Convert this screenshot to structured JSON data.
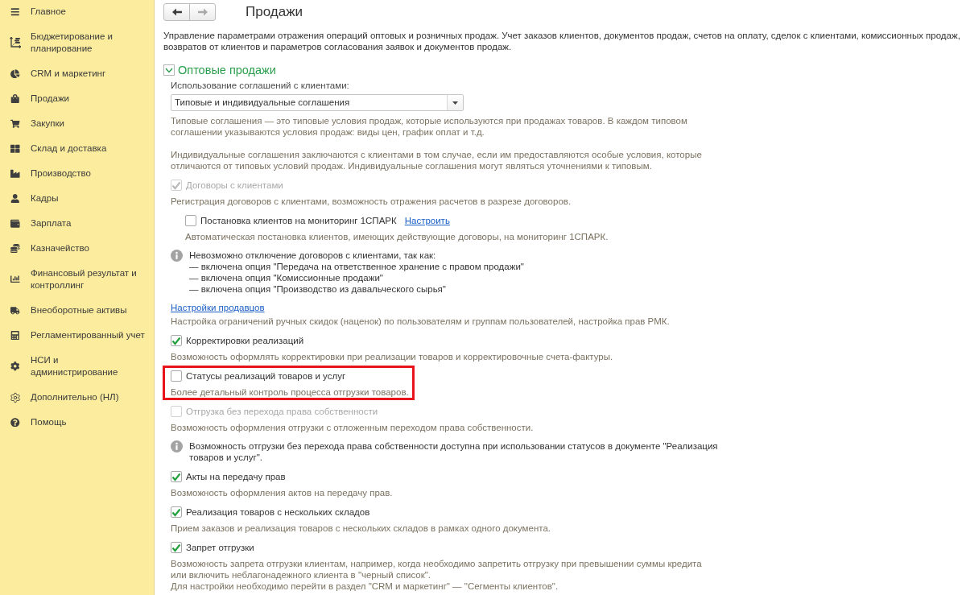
{
  "sidebar": {
    "items": [
      {
        "label": "Главное"
      },
      {
        "label": "Бюджетирование и планирование"
      },
      {
        "label": "CRM и маркетинг"
      },
      {
        "label": "Продажи"
      },
      {
        "label": "Закупки"
      },
      {
        "label": "Склад и доставка"
      },
      {
        "label": "Производство"
      },
      {
        "label": "Кадры"
      },
      {
        "label": "Зарплата"
      },
      {
        "label": "Казначейство"
      },
      {
        "label": "Финансовый результат и контроллинг"
      },
      {
        "label": "Внеоборотные активы"
      },
      {
        "label": "Регламентированный учет"
      },
      {
        "label": "НСИ и администрирование"
      },
      {
        "label": "Дополнительно (НЛ)"
      },
      {
        "label": "Помощь"
      }
    ]
  },
  "navigation": [
    {
      "kind": "back",
      "disabled": false
    },
    {
      "kind": "forward",
      "disabled": true
    }
  ],
  "page": {
    "title": "Продажи",
    "description": "Управление параметрами отражения операций оптовых и розничных продаж. Учет заказов клиентов, документов продаж, счетов на оплату, сделок с клиентами, комиссионных продаж, возвратов от клиентов и параметров согласования заявок и документов продаж."
  },
  "group": {
    "title": "Оптовые продажи",
    "expanded": true,
    "items": [
      {
        "kind": "select",
        "label": "Использование соглашений с клиентами:",
        "value": "Типовые и индивидуальные соглашения"
      },
      {
        "kind": "hint",
        "text": "Типовые соглашения — это типовые условия продаж, которые используются при продажах товаров. В каждом типовом соглашении указываются условия продаж: виды цен, график оплат и т.д.\n\nИндивидуальные соглашения заключаются с клиентами в том случае, если им предоставляются особые условия, которые отличаются от типовых условий продаж. Индивидуальные соглашения могут являться уточнениями к типовым."
      },
      {
        "kind": "checkbox",
        "label": "Договоры с клиентами",
        "checked": true,
        "disabled": true,
        "highlighted": false,
        "hint": "Регистрация договоров с клиентами, возможность отражения расчетов в разрезе договоров.",
        "children": [
          {
            "kind": "checkbox",
            "label": "Постановка клиентов на мониторинг 1СПАРК",
            "checked": false,
            "disabled": false,
            "highlighted": false,
            "link": "Настроить",
            "hint": "Автоматическая постановка клиентов, имеющих действующие договоры, на мониторинг 1СПАРК."
          }
        ]
      },
      {
        "kind": "info",
        "text": "Невозможно отключение договоров с клиентами, так как:\n— включена опция \"Передача на ответственное хранение с правом продажи\"\n— включена опция \"Комиссионные продажи\"\n— включена опция \"Производство из давальческого сырья\""
      },
      {
        "kind": "link",
        "label": "Настройки продавцов",
        "hint": "Настройка ограничений ручных скидок (наценок) по пользователям и группам пользователей, настройка прав РМК."
      },
      {
        "kind": "checkbox",
        "label": "Корректировки реализаций",
        "checked": true,
        "disabled": false,
        "highlighted": false,
        "hint": "Возможность оформлять корректировки при реализации товаров и корректировочные счета-фактуры."
      },
      {
        "kind": "checkbox",
        "label": "Статусы реализаций товаров и услуг",
        "checked": false,
        "disabled": false,
        "highlighted": true,
        "hint": "Более детальный контроль процесса отгрузки товаров."
      },
      {
        "kind": "checkbox",
        "label": "Отгрузка без перехода права собственности",
        "checked": false,
        "disabled": true,
        "highlighted": false,
        "hint": "Возможность оформления отгрузки с отложенным переходом права собственности."
      },
      {
        "kind": "info",
        "text": "Возможность отгрузки без перехода права собственности доступна при использовании статусов в документе \"Реализация товаров и услуг\"."
      },
      {
        "kind": "checkbox",
        "label": "Акты на передачу прав",
        "checked": true,
        "disabled": false,
        "highlighted": false,
        "hint": "Возможность оформления актов на передачу прав."
      },
      {
        "kind": "checkbox",
        "label": "Реализация товаров с нескольких складов",
        "checked": true,
        "disabled": false,
        "highlighted": false,
        "hint": "Прием заказов и реализация товаров с нескольких складов в рамках одного документа."
      },
      {
        "kind": "checkbox",
        "label": "Запрет отгрузки",
        "checked": true,
        "disabled": false,
        "highlighted": false,
        "hint": "Возможность запрета отгрузки клиентам, например, когда необходимо запретить отгрузку при превышении суммы кредита или включить неблагонадежного клиента в \"черный список\".\nДля настройки необходимо перейти в раздел \"CRM и маркетинг\" — \"Сегменты клиентов\"."
      }
    ]
  }
}
